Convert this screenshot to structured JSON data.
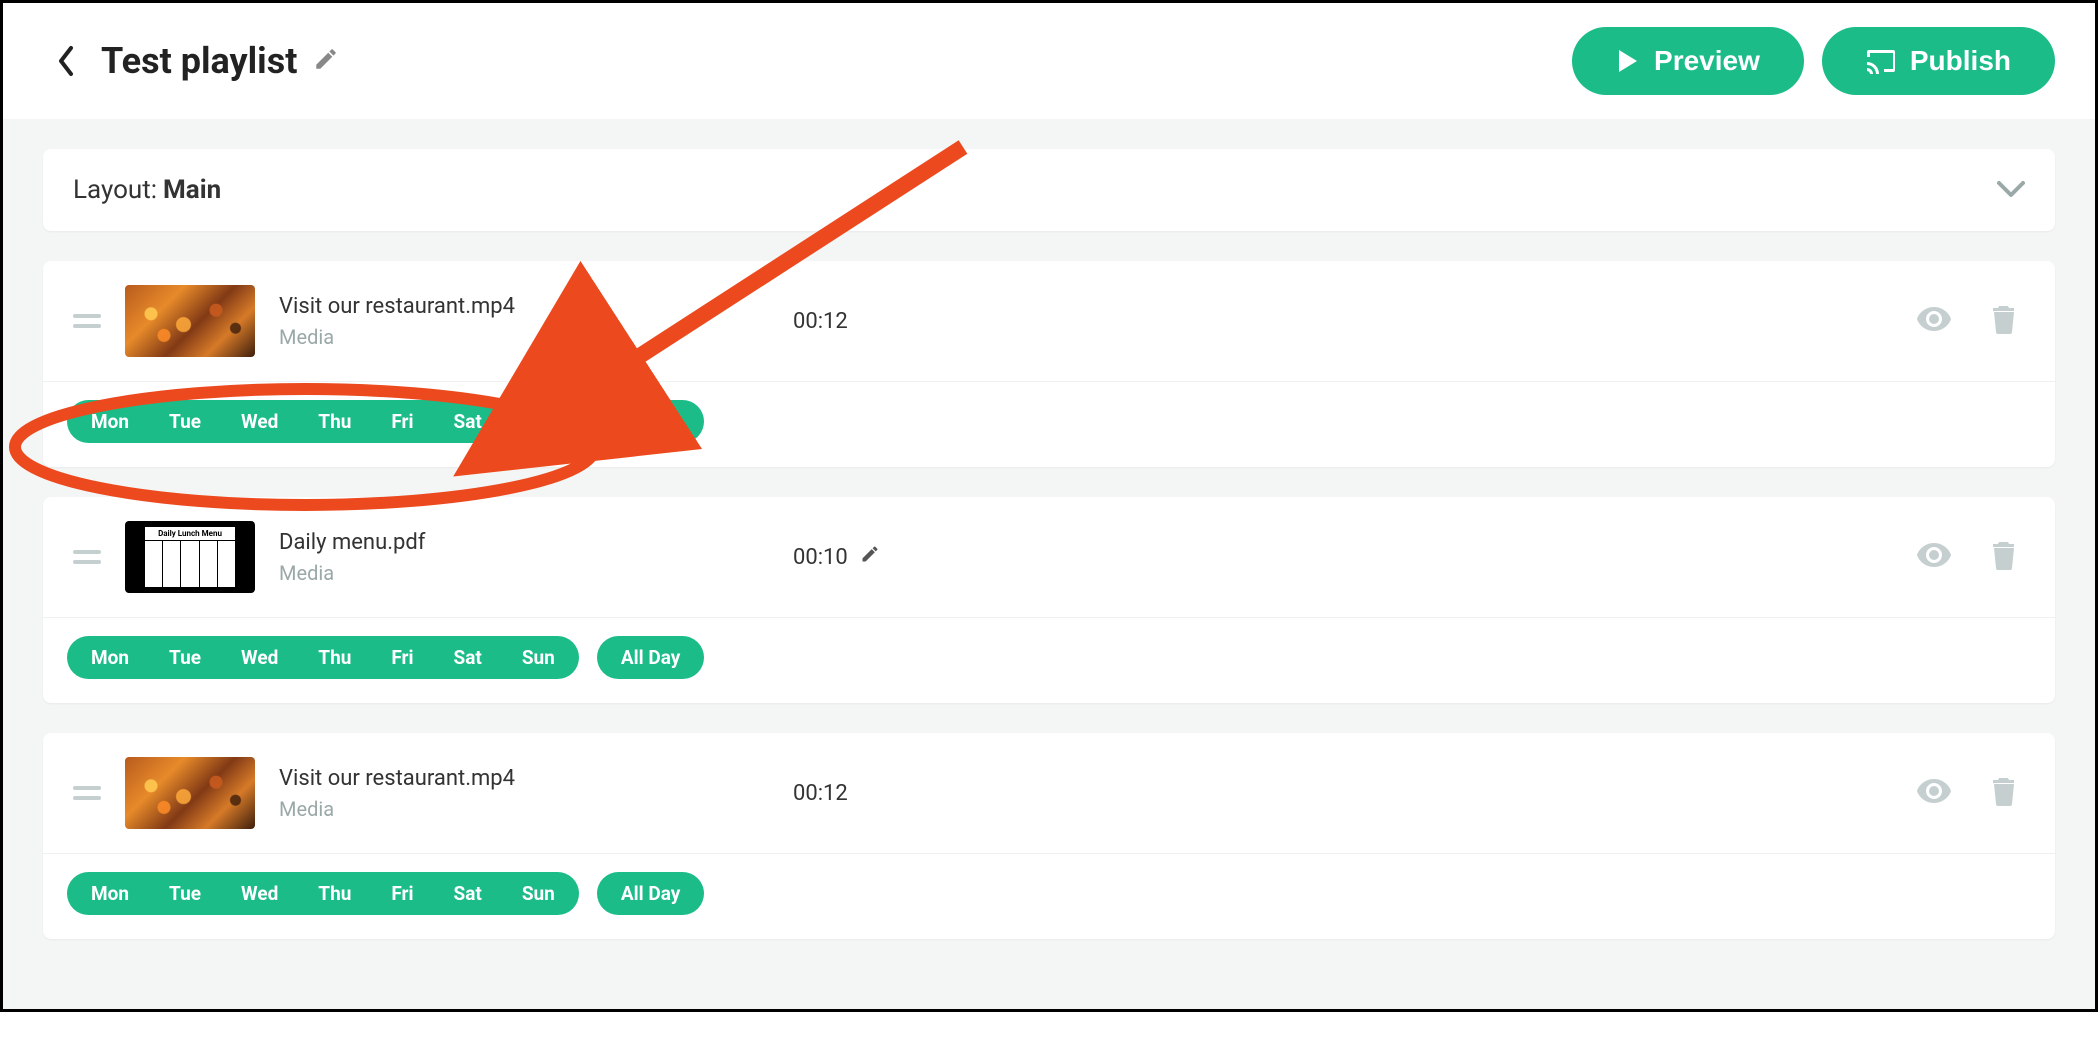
{
  "header": {
    "title": "Test playlist",
    "preview_label": "Preview",
    "publish_label": "Publish"
  },
  "layout": {
    "prefix": "Layout:",
    "name": "Main"
  },
  "days": [
    "Mon",
    "Tue",
    "Wed",
    "Thu",
    "Fri",
    "Sat",
    "Sun"
  ],
  "allday_label": "All Day",
  "items": [
    {
      "title": "Visit our restaurant.mp4",
      "type": "Media",
      "duration": "00:12",
      "editable_duration": false,
      "thumb": "food"
    },
    {
      "title": "Daily menu.pdf",
      "type": "Media",
      "duration": "00:10",
      "editable_duration": true,
      "thumb": "pdf",
      "thumb_caption": "Daily Lunch Menu"
    },
    {
      "title": "Visit our restaurant.mp4",
      "type": "Media",
      "duration": "00:12",
      "editable_duration": false,
      "thumb": "food"
    }
  ],
  "annotation": {
    "type": "ellipse+arrow",
    "color": "#ec4a1e"
  }
}
